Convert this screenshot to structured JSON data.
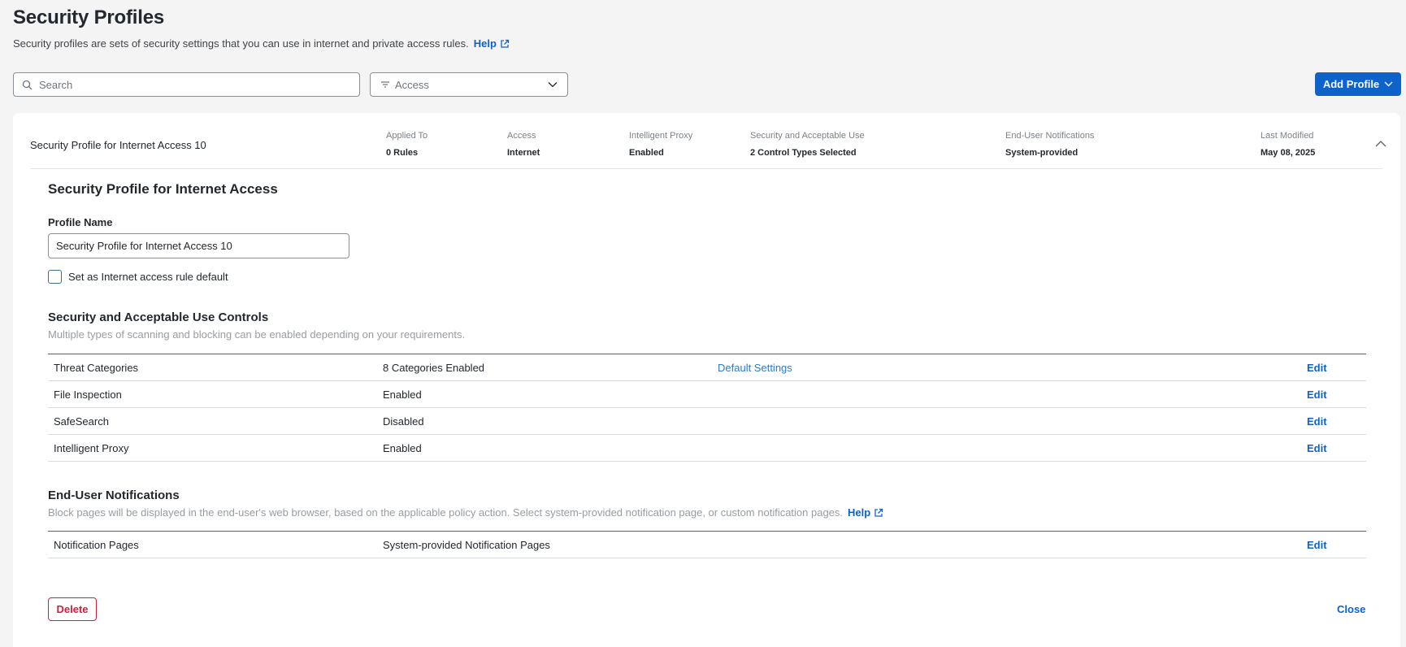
{
  "header": {
    "title": "Security Profiles",
    "description": "Security profiles are sets of security settings that you can use in internet and private access rules.",
    "help_label": "Help"
  },
  "toolbar": {
    "search_placeholder": "Search",
    "filter_label": "Access",
    "add_profile_label": "Add Profile"
  },
  "profile_summary": {
    "name": "Security Profile for Internet Access 10",
    "columns": [
      {
        "label": "Applied To",
        "value": "0 Rules"
      },
      {
        "label": "Access",
        "value": "Internet"
      },
      {
        "label": "Intelligent Proxy",
        "value": "Enabled"
      },
      {
        "label": "Security and Acceptable Use",
        "value": "2 Control Types Selected"
      },
      {
        "label": "End-User Notifications",
        "value": "System-provided"
      },
      {
        "label": "Last Modified",
        "value": "May 08, 2025"
      }
    ]
  },
  "profile_detail": {
    "title": "Security Profile for Internet Access",
    "profile_name_label": "Profile Name",
    "profile_name_value": "Security Profile for Internet Access 10",
    "default_checkbox_label": "Set as Internet access rule default",
    "default_checked": false
  },
  "security_controls": {
    "title": "Security and Acceptable Use Controls",
    "description": "Multiple types of scanning and blocking can be enabled depending on your requirements.",
    "rows": [
      {
        "name": "Threat Categories",
        "status": "8 Categories Enabled",
        "link": "Default Settings",
        "action": "Edit"
      },
      {
        "name": "File Inspection",
        "status": "Enabled",
        "link": "",
        "action": "Edit"
      },
      {
        "name": "SafeSearch",
        "status": "Disabled",
        "link": "",
        "action": "Edit"
      },
      {
        "name": "Intelligent Proxy",
        "status": "Enabled",
        "link": "",
        "action": "Edit"
      }
    ]
  },
  "notifications": {
    "title": "End-User Notifications",
    "description": "Block pages will be displayed in the end-user's web browser, based on the applicable policy action. Select system-provided notification page, or custom notification pages.",
    "help_label": "Help",
    "rows": [
      {
        "name": "Notification Pages",
        "status": "System-provided Notification Pages",
        "action": "Edit"
      }
    ]
  },
  "footer": {
    "delete_label": "Delete",
    "close_label": "Close"
  },
  "colors": {
    "primary": "#0d63c9",
    "danger": "#c9223f",
    "background": "#f4f4f4"
  }
}
